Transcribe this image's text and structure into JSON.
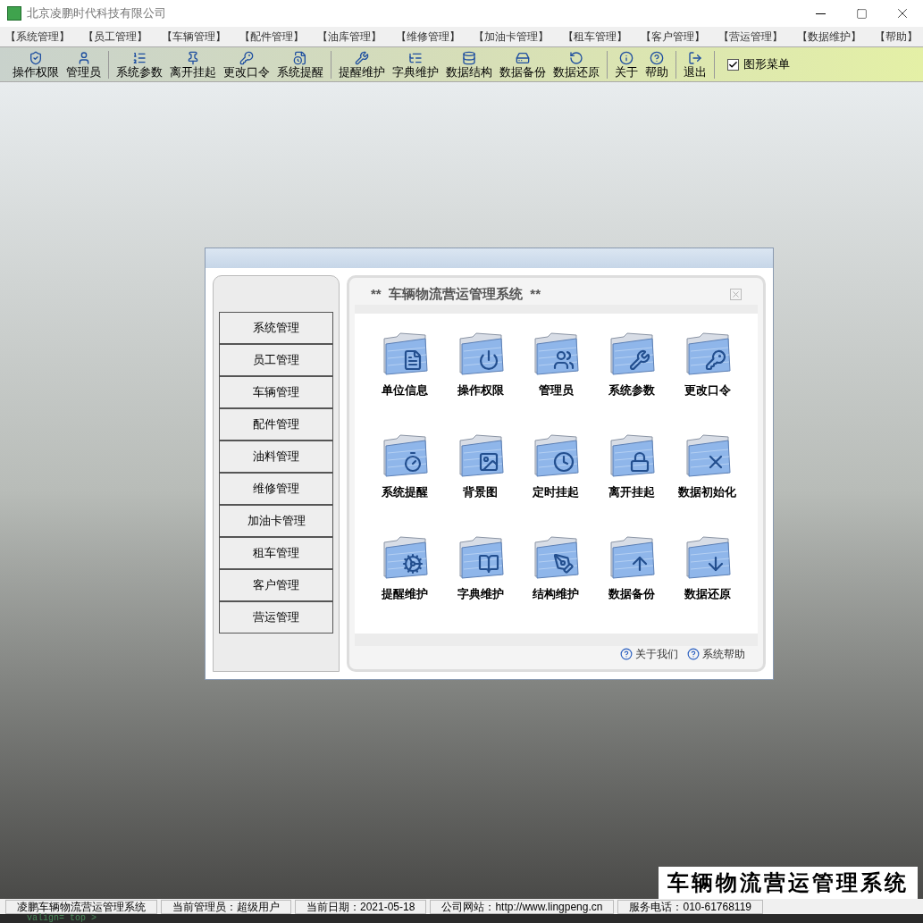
{
  "window": {
    "title": "北京凌鹏时代科技有限公司"
  },
  "menu_bar": [
    "【系统管理】",
    "【员工管理】",
    "【车辆管理】",
    "【配件管理】",
    "【油库管理】",
    "【维修管理】",
    "【加油卡管理】",
    "【租车管理】",
    "【客户管理】",
    "【营运管理】",
    "【数据维护】",
    "【帮助】"
  ],
  "toolbar": {
    "groups": [
      [
        "操作权限",
        "管理员"
      ],
      [
        "系统参数",
        "离开挂起",
        "更改口令",
        "系统提醒"
      ],
      [
        "提醒维护",
        "字典维护",
        "数据结构",
        "数据备份",
        "数据还原"
      ],
      [
        "关于",
        "帮助"
      ],
      [
        "退出"
      ]
    ],
    "graphic_menu": {
      "label": "图形菜单",
      "checked": true
    }
  },
  "dialog": {
    "sidebar": {
      "items": [
        "系统管理",
        "员工管理",
        "车辆管理",
        "配件管理",
        "油料管理",
        "维修管理",
        "加油卡管理",
        "租车管理",
        "客户管理",
        "营运管理"
      ]
    },
    "panel": {
      "title": "**  车辆物流营运管理系统  **",
      "tiles": [
        "单位信息",
        "操作权限",
        "管理员",
        "系统参数",
        "更改口令",
        "系统提醒",
        "背景图",
        "定时挂起",
        "离开挂起",
        "数据初始化",
        "提醒维护",
        "字典维护",
        "结构维护",
        "数据备份",
        "数据还原"
      ],
      "footer_links": [
        "关于我们",
        "系统帮助"
      ]
    }
  },
  "banner": "车辆物流营运管理系统",
  "status_bar": [
    "凌鹏车辆物流营运管理系统",
    "当前管理员：超级用户",
    "当前日期：2021-05-18",
    "公司网站：http://www.lingpeng.cn",
    "服务电话：010-61768119"
  ],
  "stray_text": "valign= top >"
}
